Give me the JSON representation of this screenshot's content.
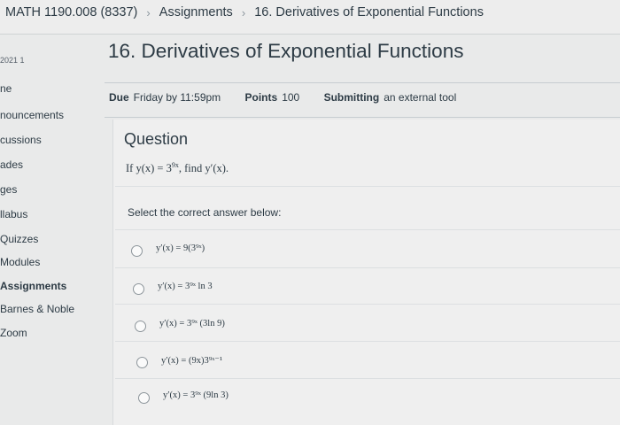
{
  "breadcrumb": {
    "course": "MATH 1190.008 (8337)",
    "section": "Assignments",
    "page": "16. Derivatives of Exponential Functions",
    "separator": "›"
  },
  "sidebar": {
    "term": "2021 1",
    "items": [
      {
        "label": "ne",
        "active": false
      },
      {
        "label": "nouncements",
        "active": false
      },
      {
        "label": "cussions",
        "active": false
      },
      {
        "label": "ades",
        "active": false
      },
      {
        "label": "ges",
        "active": false
      },
      {
        "label": "llabus",
        "active": false
      },
      {
        "label": "Quizzes",
        "active": false
      },
      {
        "label": "Modules",
        "active": false
      },
      {
        "label": "Assignments",
        "active": true
      },
      {
        "label": "Barnes & Noble",
        "active": false
      },
      {
        "label": "Zoom",
        "active": false
      }
    ]
  },
  "assignment": {
    "title": "16. Derivatives of Exponential Functions",
    "due_label": "Due",
    "due_value": "Friday by 11:59pm",
    "points_label": "Points",
    "points_value": "100",
    "submitting_label": "Submitting",
    "submitting_value": "an external tool"
  },
  "question": {
    "heading": "Question",
    "text_prefix": "If y(x) = 3",
    "text_exp": "9x",
    "text_suffix": ", find y′(x).",
    "prompt": "Select the correct answer below:",
    "options": [
      "y′(x) = 9(3⁹ˣ)",
      "y′(x) = 3⁹ˣ ln 3",
      "y′(x) = 3⁹ˣ (3ln 9)",
      "y′(x) = (9x)3⁹ˣ⁻¹",
      "y′(x) = 3⁹ˣ (9ln 3)"
    ]
  }
}
